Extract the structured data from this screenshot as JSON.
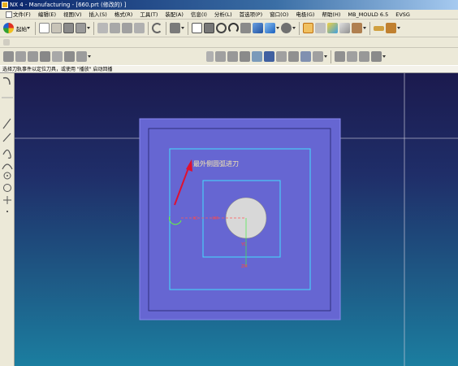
{
  "window": {
    "title": "NX 4 - Manufacturing - [660.prt (修改的) ]"
  },
  "menubar": {
    "items": [
      {
        "label": "文件(F)"
      },
      {
        "label": "编辑(E)"
      },
      {
        "label": "视图(V)"
      },
      {
        "label": "插入(S)"
      },
      {
        "label": "格式(R)"
      },
      {
        "label": "工具(T)"
      },
      {
        "label": "装配(A)"
      },
      {
        "label": "信息(I)"
      },
      {
        "label": "分析(L)"
      },
      {
        "label": "首选项(P)"
      },
      {
        "label": "窗口(O)"
      },
      {
        "label": "电极(G)"
      },
      {
        "label": "帮助(H)"
      },
      {
        "label": "MB_MOULD 6.5"
      },
      {
        "label": "EVSG"
      }
    ]
  },
  "toolbar": {
    "start_label": "起始"
  },
  "cue_line": {
    "text": "选择刀轨事件以定位刀具，或使用 \"播放\" 启动回播"
  },
  "annotation": {
    "text": "最外侧圆弧进刀"
  },
  "colors": {
    "viewport_top": "#1b1a4e",
    "viewport_bottom": "#1b7ea0",
    "workpiece": "#6666d2",
    "toolpath": "#44ddff",
    "arrow": "#e01030",
    "hole": "#d8d8d8"
  },
  "icons": {
    "toolbar_row1": [
      "nx-logo-icon",
      "new-icon",
      "open-icon",
      "save-icon",
      "print-icon",
      "cut-icon",
      "copy-icon",
      "paste-icon",
      "delete-icon",
      "undo-icon",
      "select-icon",
      "fit-icon",
      "zoom-icon",
      "rotate-icon",
      "pan-icon",
      "shaded-icon",
      "view-icon",
      "snap-icon",
      "analysis-icon",
      "measure-icon",
      "layer-icon",
      "settings-icon"
    ],
    "toolbar_row3": [
      "operation-icon",
      "program-icon",
      "tool-icon",
      "geometry-icon",
      "method-icon",
      "generate-icon",
      "verify-icon",
      "postprocess-icon",
      "shop-doc-icon",
      "list-icon"
    ],
    "left_toolbar": [
      "fillet-icon",
      "line-icon",
      "arc-icon",
      "spline-icon",
      "circle-icon",
      "point-icon",
      "plus-icon"
    ]
  }
}
